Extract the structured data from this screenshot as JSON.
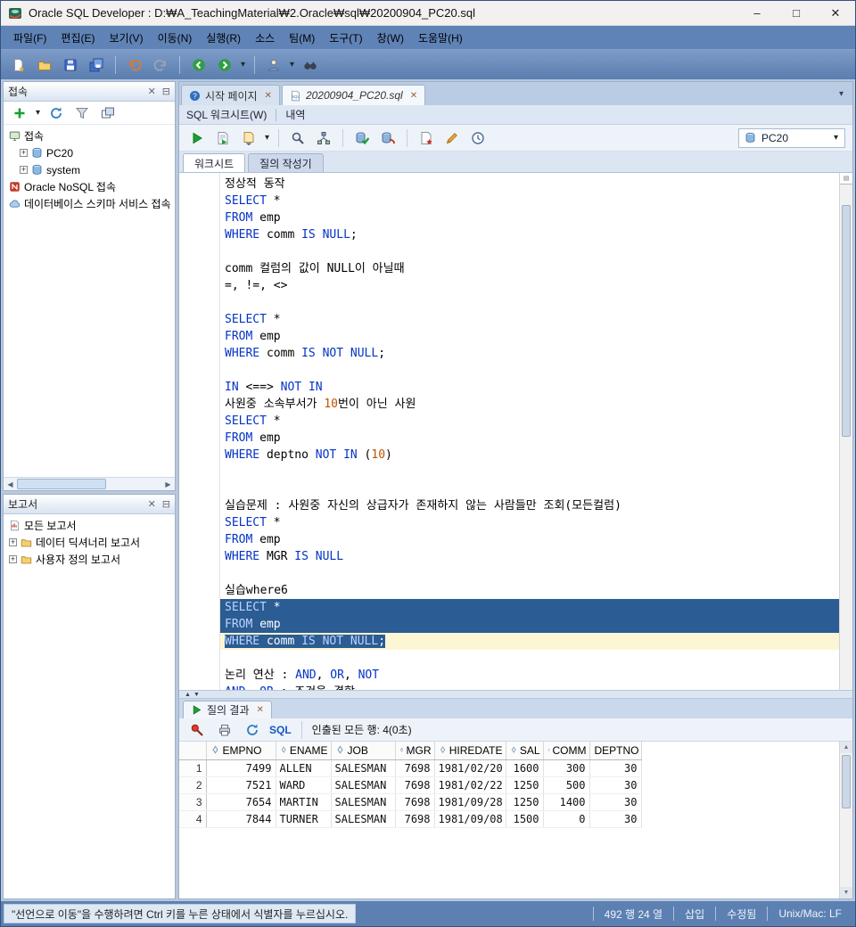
{
  "colors": {
    "chrome": "#5f83b6",
    "kw": "#0433c6",
    "num": "#c05000",
    "sel": "#2b5c93",
    "cur": "#fcf6d4",
    "status": "#5c80b2"
  },
  "titlebar": {
    "title": "Oracle SQL Developer : D:₩A_TeachingMaterial₩2.Oracle₩sql₩20200904_PC20.sql",
    "controls": {
      "min": "–",
      "max": "□",
      "close": "✕"
    }
  },
  "menubar": {
    "items": [
      {
        "name": "menu-file",
        "label": "파일(F)"
      },
      {
        "name": "menu-edit",
        "label": "편집(E)"
      },
      {
        "name": "menu-view",
        "label": "보기(V)"
      },
      {
        "name": "menu-navigate",
        "label": "이동(N)"
      },
      {
        "name": "menu-run",
        "label": "실행(R)"
      },
      {
        "name": "menu-source",
        "label": "소스"
      },
      {
        "name": "menu-team",
        "label": "팀(M)"
      },
      {
        "name": "menu-tools",
        "label": "도구(T)"
      },
      {
        "name": "menu-window",
        "label": "창(W)"
      },
      {
        "name": "menu-help",
        "label": "도움말(H)"
      }
    ]
  },
  "main_toolbar": {
    "items": [
      {
        "name": "new-file-button",
        "icon": "page-new"
      },
      {
        "name": "open-file-button",
        "icon": "folder"
      },
      {
        "name": "save-button",
        "icon": "floppy"
      },
      {
        "name": "save-all-button",
        "icon": "floppy-all"
      },
      {
        "sep": true
      },
      {
        "name": "undo-button",
        "icon": "undo"
      },
      {
        "name": "redo-button",
        "icon": "redo"
      },
      {
        "sep": true
      },
      {
        "name": "back-button",
        "icon": "back"
      },
      {
        "name": "forward-button",
        "icon": "fwd"
      },
      {
        "caret": true
      },
      {
        "sep": true
      },
      {
        "name": "connection-user-button",
        "icon": "person"
      },
      {
        "caret": true
      },
      {
        "name": "search-button",
        "icon": "binoculars"
      }
    ]
  },
  "connections_panel": {
    "title": "접속",
    "header_buttons": [
      {
        "name": "close-panel-button",
        "glyph": "✕"
      },
      {
        "name": "minimize-panel-button",
        "glyph": "⊟"
      }
    ],
    "toolbar": [
      {
        "name": "add-connection-button",
        "icon": "plus"
      },
      {
        "caret": true
      },
      {
        "name": "refresh-button",
        "icon": "refresh"
      },
      {
        "name": "filter-button",
        "icon": "funnel"
      },
      {
        "name": "cascade-button",
        "icon": "cascade"
      }
    ],
    "tree": [
      {
        "name": "tree-item-connections-root",
        "label": "접속",
        "icon": "monitor",
        "indent": 0,
        "expandable": false
      },
      {
        "name": "tree-item-pc20",
        "label": "PC20",
        "icon": "db",
        "indent": 1,
        "expandable": true
      },
      {
        "name": "tree-item-system",
        "label": "system",
        "icon": "db",
        "indent": 1,
        "expandable": true
      },
      {
        "name": "tree-item-nosql",
        "label": "Oracle NoSQL 접속",
        "icon": "nosql",
        "indent": 0,
        "expandable": false
      },
      {
        "name": "tree-item-cloud",
        "label": "데이터베이스 스키마 서비스 접속",
        "icon": "cloud",
        "indent": 0,
        "expandable": false
      }
    ]
  },
  "reports_panel": {
    "title": "보고서",
    "header_buttons": [
      {
        "name": "close-panel-button",
        "glyph": "✕"
      },
      {
        "name": "minimize-panel-button",
        "glyph": "⊟"
      }
    ],
    "tree": [
      {
        "name": "tree-item-all-reports",
        "label": "모든 보고서",
        "icon": "report",
        "indent": 0,
        "expandable": false
      },
      {
        "name": "tree-item-dict-reports",
        "label": "데이터 딕셔너리 보고서",
        "icon": "folder",
        "indent": 0,
        "expandable": true
      },
      {
        "name": "tree-item-user-reports",
        "label": "사용자 정의 보고서",
        "icon": "folder",
        "indent": 0,
        "expandable": true
      }
    ]
  },
  "doc_tabs": {
    "tabs": [
      {
        "name": "tab-start-page",
        "label": "시작 페이지",
        "icon": "help",
        "active": false
      },
      {
        "name": "tab-sql-file",
        "label": "20200904_PC20.sql",
        "icon": "sqlfile",
        "active": true
      }
    ],
    "chevron": "▾"
  },
  "worksheet_header": {
    "left": "SQL 워크시트(W)",
    "right": "내역"
  },
  "worksheet_toolbar": {
    "items": [
      {
        "name": "run-statement-button",
        "icon": "play"
      },
      {
        "name": "run-script-button",
        "icon": "script"
      },
      {
        "name": "saved-sql-button",
        "icon": "docdd"
      },
      {
        "caret": true
      },
      {
        "sep": true
      },
      {
        "name": "autotrace-button",
        "icon": "magnify"
      },
      {
        "name": "explain-plan-button",
        "icon": "explain"
      },
      {
        "sep": true
      },
      {
        "name": "commit-button",
        "icon": "commit"
      },
      {
        "name": "rollback-button",
        "icon": "rollback"
      },
      {
        "sep": true
      },
      {
        "name": "unshared-worksheet-button",
        "icon": "unshared"
      },
      {
        "name": "clear-button",
        "icon": "pencil"
      },
      {
        "name": "sql-history-button",
        "icon": "clock"
      }
    ],
    "connection": {
      "value": "PC20"
    }
  },
  "worksheet_tabs": [
    {
      "name": "tab-worksheet",
      "label": "워크시트",
      "active": true
    },
    {
      "name": "tab-query-builder",
      "label": "질의 작성기",
      "active": false
    }
  ],
  "editor": {
    "lines": [
      {
        "t": [
          [
            "p",
            "정상적 동작"
          ]
        ]
      },
      {
        "t": [
          [
            "k",
            "SELECT"
          ],
          [
            "p",
            " *"
          ]
        ]
      },
      {
        "t": [
          [
            "k",
            "FROM"
          ],
          [
            "p",
            " emp"
          ]
        ]
      },
      {
        "t": [
          [
            "k",
            "WHERE"
          ],
          [
            "p",
            " comm "
          ],
          [
            "k",
            "IS"
          ],
          [
            "p",
            " "
          ],
          [
            "k",
            "NULL"
          ],
          [
            "p",
            ";"
          ]
        ]
      },
      {
        "t": []
      },
      {
        "t": [
          [
            "p",
            "comm 컬럼의 값이 NULL이 아닐때"
          ]
        ]
      },
      {
        "t": [
          [
            "p",
            "=, !=, <>"
          ]
        ]
      },
      {
        "t": []
      },
      {
        "t": [
          [
            "k",
            "SELECT"
          ],
          [
            "p",
            " *"
          ]
        ]
      },
      {
        "t": [
          [
            "k",
            "FROM"
          ],
          [
            "p",
            " emp"
          ]
        ]
      },
      {
        "t": [
          [
            "k",
            "WHERE"
          ],
          [
            "p",
            " comm "
          ],
          [
            "k",
            "IS"
          ],
          [
            "p",
            " "
          ],
          [
            "k",
            "NOT"
          ],
          [
            "p",
            " "
          ],
          [
            "k",
            "NULL"
          ],
          [
            "p",
            ";"
          ]
        ]
      },
      {
        "t": []
      },
      {
        "t": [
          [
            "k",
            "IN"
          ],
          [
            "p",
            " <==> "
          ],
          [
            "k",
            "NOT"
          ],
          [
            "p",
            " "
          ],
          [
            "k",
            "IN"
          ]
        ]
      },
      {
        "t": [
          [
            "p",
            "사원중 소속부서가 "
          ],
          [
            "n",
            "10"
          ],
          [
            "p",
            "번이 아닌 사원"
          ]
        ]
      },
      {
        "t": [
          [
            "k",
            "SELECT"
          ],
          [
            "p",
            " *"
          ]
        ]
      },
      {
        "t": [
          [
            "k",
            "FROM"
          ],
          [
            "p",
            " emp"
          ]
        ]
      },
      {
        "t": [
          [
            "k",
            "WHERE"
          ],
          [
            "p",
            " deptno "
          ],
          [
            "k",
            "NOT"
          ],
          [
            "p",
            " "
          ],
          [
            "k",
            "IN"
          ],
          [
            "p",
            " ("
          ],
          [
            "n",
            "10"
          ],
          [
            "p",
            ")"
          ]
        ]
      },
      {
        "t": []
      },
      {
        "t": []
      },
      {
        "t": [
          [
            "p",
            "실습문제 : 사원중 자신의 상급자가 존재하지 않는 사람들만 조회(모든컬럼)"
          ]
        ]
      },
      {
        "t": [
          [
            "k",
            "SELECT"
          ],
          [
            "p",
            " *"
          ]
        ]
      },
      {
        "t": [
          [
            "k",
            "FROM"
          ],
          [
            "p",
            " emp"
          ]
        ]
      },
      {
        "t": [
          [
            "k",
            "WHERE"
          ],
          [
            "p",
            " MGR "
          ],
          [
            "k",
            "IS"
          ],
          [
            "p",
            " "
          ],
          [
            "k",
            "NULL"
          ]
        ]
      },
      {
        "t": []
      },
      {
        "t": [
          [
            "p",
            "실습where6"
          ]
        ]
      },
      {
        "t": [
          [
            "k",
            "SELECT"
          ],
          [
            "p",
            " *"
          ]
        ],
        "sel": "full"
      },
      {
        "t": [
          [
            "k",
            "FROM"
          ],
          [
            "p",
            " emp"
          ]
        ],
        "sel": "full"
      },
      {
        "t": [
          [
            "k",
            "WHERE"
          ],
          [
            "p",
            " comm "
          ],
          [
            "k",
            "IS"
          ],
          [
            "p",
            " "
          ],
          [
            "k",
            "NOT"
          ],
          [
            "p",
            " "
          ],
          [
            "k",
            "NULL"
          ],
          [
            "p",
            ";"
          ]
        ],
        "sel": "text",
        "cur": true
      },
      {
        "t": []
      },
      {
        "t": [
          [
            "p",
            "논리 연산 : "
          ],
          [
            "k",
            "AND"
          ],
          [
            "p",
            ", "
          ],
          [
            "k",
            "OR"
          ],
          [
            "p",
            ", "
          ],
          [
            "k",
            "NOT"
          ]
        ]
      },
      {
        "t": [
          [
            "k",
            "AND"
          ],
          [
            "p",
            ", "
          ],
          [
            "k",
            "OR"
          ],
          [
            "p",
            " : 조건을 결합"
          ]
        ]
      }
    ]
  },
  "results": {
    "tab_label": "질의 결과",
    "toolbar": {
      "icons": [
        {
          "name": "pin-button",
          "icon": "pin"
        },
        {
          "name": "print-button",
          "icon": "print"
        },
        {
          "name": "refresh-results-button",
          "icon": "refresh"
        }
      ],
      "sql_label": "SQL",
      "status": "인출된 모든 행: 4(0초)"
    },
    "grid": {
      "columns": [
        "EMPNO",
        "ENAME",
        "JOB",
        "MGR",
        "HIREDATE",
        "SAL",
        "COMM",
        "DEPTNO"
      ],
      "align": [
        "right",
        "left",
        "left",
        "right",
        "left",
        "right",
        "right",
        "right"
      ],
      "rows": [
        [
          "1",
          "7499",
          "ALLEN",
          "SALESMAN",
          "7698",
          "1981/02/20",
          "1600",
          "300",
          "30"
        ],
        [
          "2",
          "7521",
          "WARD",
          "SALESMAN",
          "7698",
          "1981/02/22",
          "1250",
          "500",
          "30"
        ],
        [
          "3",
          "7654",
          "MARTIN",
          "SALESMAN",
          "7698",
          "1981/09/28",
          "1250",
          "1400",
          "30"
        ],
        [
          "4",
          "7844",
          "TURNER",
          "SALESMAN",
          "7698",
          "1981/09/08",
          "1500",
          "0",
          "30"
        ]
      ]
    }
  },
  "statusbar": {
    "hint": "\"선언으로 이동\"을 수행하려면 Ctrl 키를 누른 상태에서 식별자를 누르십시오.",
    "segments": [
      "492 행 24 열",
      "삽입",
      "수정됨",
      "Unix/Mac: LF"
    ]
  }
}
